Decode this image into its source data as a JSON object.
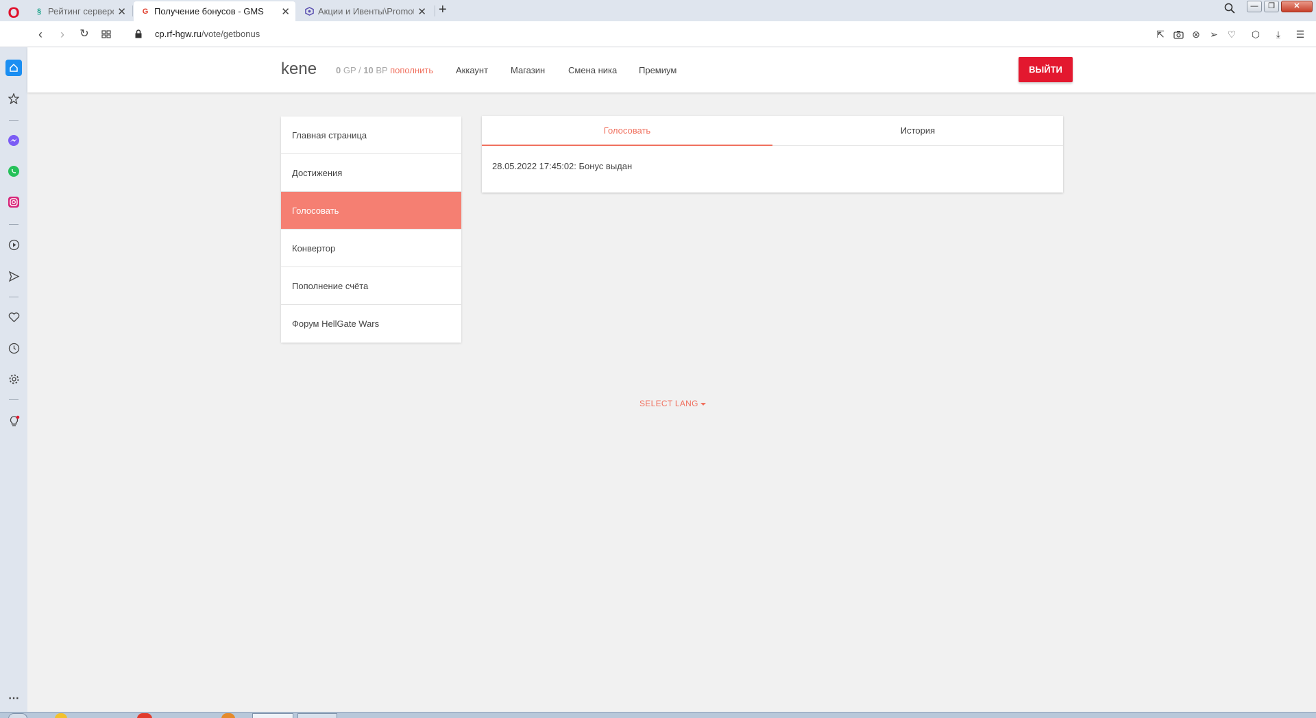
{
  "browser": {
    "tabs": [
      {
        "title": "Рейтинг серверов RF Online",
        "favicon": "rating-favicon",
        "active": false
      },
      {
        "title": "Получение бонусов - GMS",
        "favicon": "gms-favicon",
        "active": true
      },
      {
        "title": "Акции и Ивенты\\Promotions",
        "favicon": "promo-favicon",
        "active": false
      }
    ],
    "new_tab": "+",
    "url_host": "cp.rf-hgw.ru",
    "url_path": "/vote/getbonus",
    "window_controls": {
      "minimize": "—",
      "restore": "❐",
      "close": "✕"
    }
  },
  "site": {
    "brand": "kene",
    "balance": {
      "gp": "0",
      "gp_label": "GP",
      "separator": "/",
      "bp": "10",
      "bp_label": "BP",
      "topup": "пополнить"
    },
    "nav": [
      "Аккаунт",
      "Магазин",
      "Смена ника",
      "Премиум"
    ],
    "logout": "ВЫЙТИ"
  },
  "menu": {
    "items": [
      "Главная страница",
      "Достижения",
      "Голосовать",
      "Конвертор",
      "Пополнение счёта",
      "Форум HellGate Wars"
    ],
    "active_index": 2
  },
  "vote": {
    "tabs": [
      "Голосовать",
      "История"
    ],
    "active_tab": 0,
    "message": "28.05.2022 17:45:02: Бонус выдан"
  },
  "footer": {
    "select_lang": "SELECT LANG"
  },
  "colors": {
    "accent": "#f0705e",
    "active_menu": "#f57f72",
    "logout": "#e3182f"
  }
}
